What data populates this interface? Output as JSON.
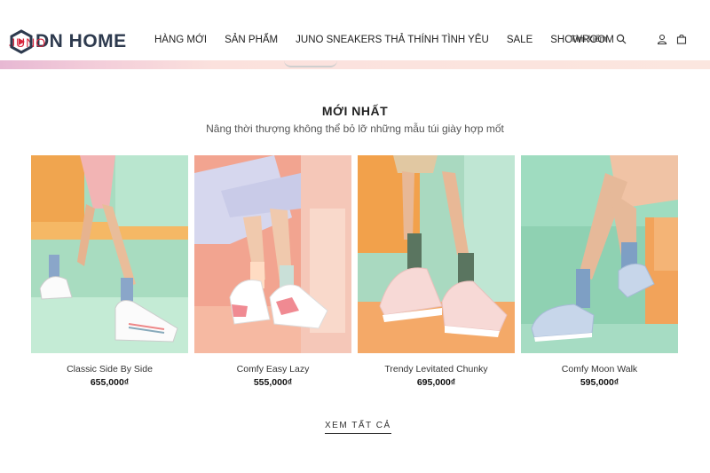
{
  "brand": {
    "juno": "JUNO",
    "name": "DN HOME"
  },
  "nav": {
    "items": [
      "HÀNG MỚI",
      "SẢN PHẨM",
      "JUNO SNEAKERS THẢ THÍNH TÌNH YÊU",
      "SALE",
      "SHOWROOM"
    ]
  },
  "tools": {
    "search_label": "Tìm kiếm"
  },
  "section": {
    "title": "MỚI NHẤT",
    "subtitle": "Nâng thời thượng không thể bỏ lỡ những mẫu túi giày hợp mốt"
  },
  "products": [
    {
      "name": "Classic Side By Side",
      "price": "655,000₫"
    },
    {
      "name": "Comfy Easy Lazy",
      "price": "555,000₫"
    },
    {
      "name": "Trendy Levitated Chunky",
      "price": "695,000₫"
    },
    {
      "name": "Comfy Moon Walk",
      "price": "595,000₫"
    }
  ],
  "view_all": "XEM TẤT CẢ",
  "colors": {
    "brand_red": "#d7263d",
    "brand_navy": "#2d3a4e"
  }
}
